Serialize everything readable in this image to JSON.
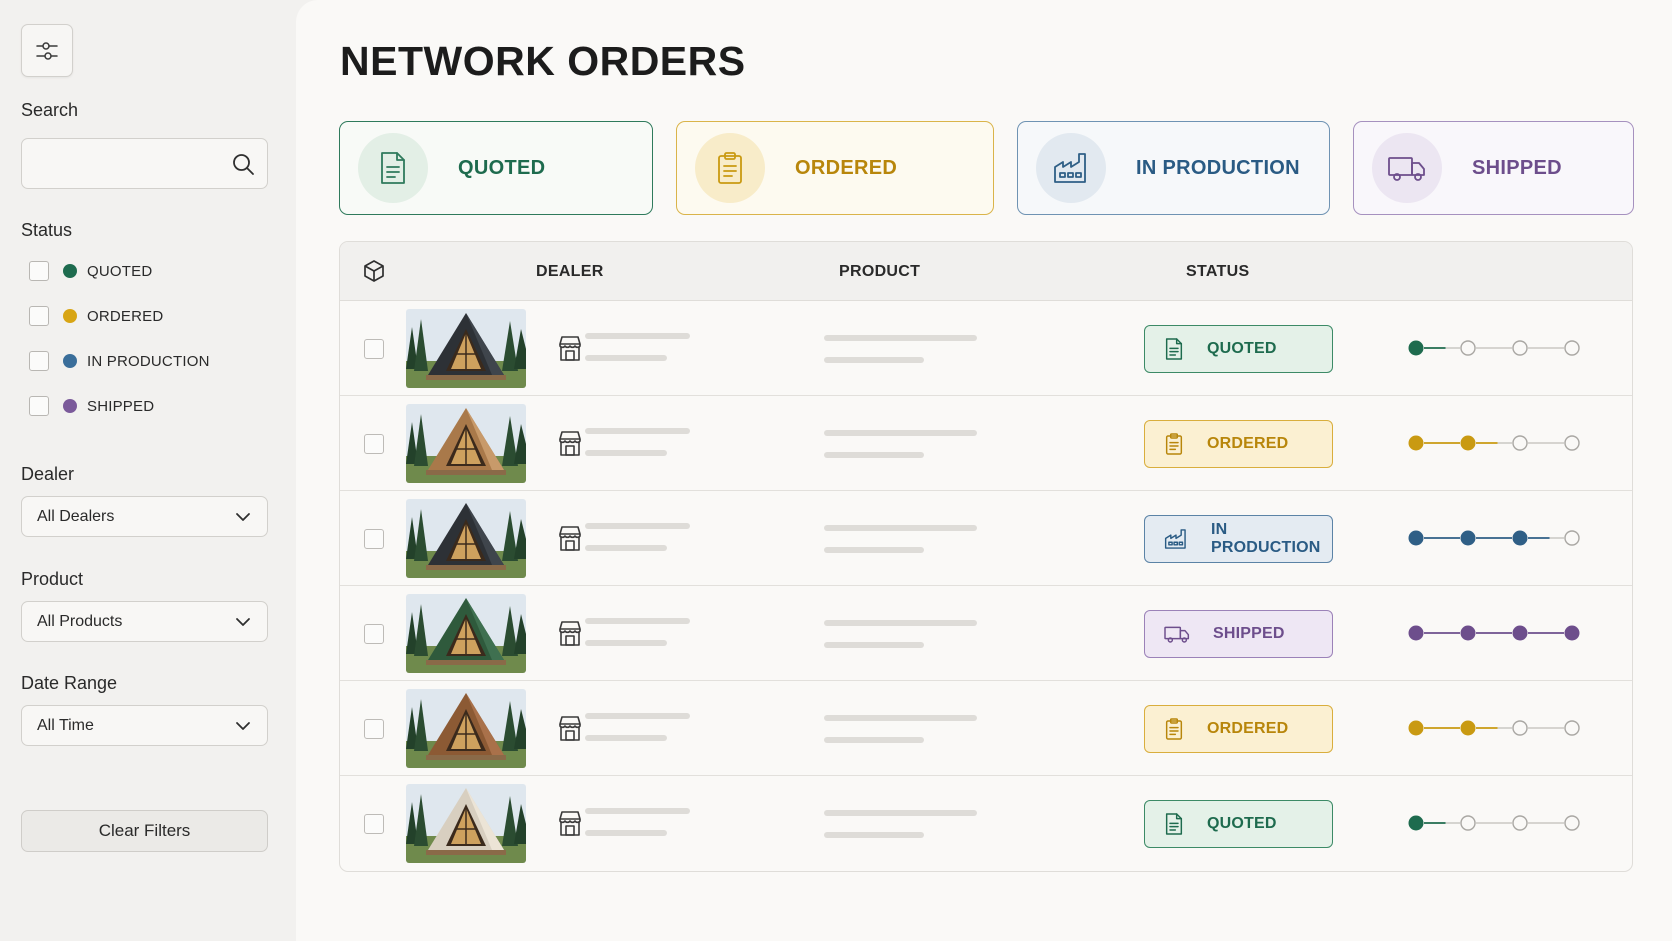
{
  "sidebar": {
    "search_label": "Search",
    "search_value": "",
    "status_label": "Status",
    "status_options": [
      {
        "label": "QUOTED",
        "color": "#1e6b4e"
      },
      {
        "label": "ORDERED",
        "color": "#d8a514"
      },
      {
        "label": "IN PRODUCTION",
        "color": "#3a6e9a"
      },
      {
        "label": "SHIPPED",
        "color": "#7b5a9a"
      }
    ],
    "dealer_label": "Dealer",
    "dealer_value": "All Dealers",
    "product_label": "Product",
    "product_value": "All Products",
    "date_label": "Date Range",
    "date_value": "All Time",
    "clear_label": "Clear Filters"
  },
  "main": {
    "title": "NETWORK ORDERS",
    "cards": [
      {
        "label": "QUOTED",
        "icon": "document-icon"
      },
      {
        "label": "ORDERED",
        "icon": "clipboard-icon"
      },
      {
        "label": "IN PRODUCTION",
        "icon": "factory-icon"
      },
      {
        "label": "SHIPPED",
        "icon": "truck-icon"
      }
    ],
    "table": {
      "header_icon": "package-icon",
      "columns": [
        "DEALER",
        "PRODUCT",
        "STATUS"
      ],
      "rows": [
        {
          "status": "QUOTED",
          "roof": "charcoal",
          "progress_steps": 1
        },
        {
          "status": "ORDERED",
          "roof": "natural-wood",
          "progress_steps": 2
        },
        {
          "status": "IN PRODUCTION",
          "roof": "charcoal",
          "progress_steps": 3
        },
        {
          "status": "SHIPPED",
          "roof": "forest-green",
          "progress_steps": 4
        },
        {
          "status": "ORDERED",
          "roof": "cedar",
          "progress_steps": 2
        },
        {
          "status": "QUOTED",
          "roof": "light-birch",
          "progress_steps": 1
        }
      ]
    }
  },
  "colors": {
    "quoted": "#1e6b4e",
    "ordered": "#c99a12",
    "in_production": "#2f5f86",
    "shipped": "#6d4e8c"
  }
}
